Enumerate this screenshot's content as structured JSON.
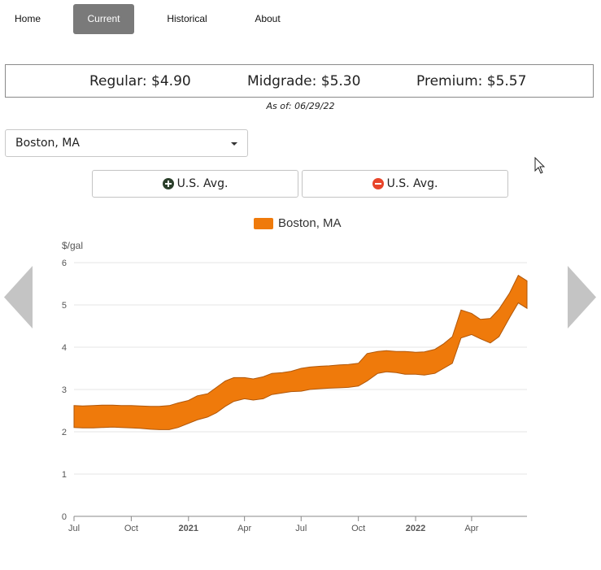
{
  "nav": {
    "items": [
      {
        "label": "Home",
        "active": false
      },
      {
        "label": "Current",
        "active": true
      },
      {
        "label": "Historical",
        "active": false
      },
      {
        "label": "About",
        "active": false
      }
    ]
  },
  "prices": {
    "regular": "Regular: $4.90",
    "midgrade": "Midgrade: $5.30",
    "premium": "Premium: $5.57",
    "as_of": "As of: 06/29/22"
  },
  "location_select": {
    "value": "Boston, MA"
  },
  "buttons": {
    "add_us_avg": "U.S. Avg.",
    "remove_us_avg": "U.S. Avg.",
    "add_icon": "plus-circle-icon",
    "remove_icon": "minus-circle-icon"
  },
  "navigation_arrows": {
    "prev_icon": "chevron-left-icon",
    "next_icon": "chevron-right-icon"
  },
  "colors": {
    "series_fill": "#ef7a0b",
    "series_stroke": "#b0570a",
    "active_tab": "#7a7a7a",
    "arrow": "#c4c4c4",
    "minus_icon": "#e8452a",
    "plus_icon": "#2b3f2b"
  },
  "chart_data": {
    "type": "area",
    "title": "",
    "ylabel": "$/gal",
    "xlabel": "",
    "ylim": [
      0,
      6
    ],
    "yticks": [
      0,
      1,
      2,
      3,
      4,
      5,
      6
    ],
    "grid": true,
    "legend": {
      "position": "top-center"
    },
    "xticks": [
      {
        "label": "Jul",
        "date": "2020-07-01",
        "bold": false
      },
      {
        "label": "Oct",
        "date": "2020-10-01",
        "bold": false
      },
      {
        "label": "2021",
        "date": "2021-01-01",
        "bold": true
      },
      {
        "label": "Apr",
        "date": "2021-04-01",
        "bold": false
      },
      {
        "label": "Jul",
        "date": "2021-07-01",
        "bold": false
      },
      {
        "label": "Oct",
        "date": "2021-10-01",
        "bold": false
      },
      {
        "label": "2022",
        "date": "2022-01-01",
        "bold": true
      },
      {
        "label": "Apr",
        "date": "2022-04-01",
        "bold": false
      }
    ],
    "xrange": [
      "2020-07-01",
      "2022-06-29"
    ],
    "series": [
      {
        "name": "Boston, MA",
        "color": "#ef7a0b",
        "band": true,
        "x": [
          "2020-07-01",
          "2020-07-15",
          "2020-08-01",
          "2020-08-15",
          "2020-09-01",
          "2020-09-15",
          "2020-10-01",
          "2020-10-15",
          "2020-11-01",
          "2020-11-15",
          "2020-12-01",
          "2020-12-15",
          "2021-01-01",
          "2021-01-15",
          "2021-02-01",
          "2021-02-15",
          "2021-03-01",
          "2021-03-15",
          "2021-04-01",
          "2021-04-15",
          "2021-05-01",
          "2021-05-15",
          "2021-06-01",
          "2021-06-15",
          "2021-07-01",
          "2021-07-15",
          "2021-08-01",
          "2021-08-15",
          "2021-09-01",
          "2021-09-15",
          "2021-10-01",
          "2021-10-15",
          "2021-11-01",
          "2021-11-15",
          "2021-12-01",
          "2021-12-15",
          "2022-01-01",
          "2022-01-15",
          "2022-02-01",
          "2022-02-15",
          "2022-03-01",
          "2022-03-15",
          "2022-04-01",
          "2022-04-15",
          "2022-05-01",
          "2022-05-15",
          "2022-06-01",
          "2022-06-15",
          "2022-06-29"
        ],
        "low": [
          2.1,
          2.09,
          2.09,
          2.1,
          2.11,
          2.1,
          2.09,
          2.08,
          2.06,
          2.05,
          2.05,
          2.1,
          2.2,
          2.28,
          2.35,
          2.45,
          2.6,
          2.72,
          2.78,
          2.75,
          2.78,
          2.88,
          2.92,
          2.95,
          2.96,
          3.0,
          3.02,
          3.03,
          3.04,
          3.05,
          3.08,
          3.2,
          3.38,
          3.42,
          3.4,
          3.36,
          3.36,
          3.34,
          3.38,
          3.5,
          3.62,
          4.22,
          4.3,
          4.2,
          4.1,
          4.25,
          4.7,
          5.05,
          4.92
        ],
        "high": [
          2.62,
          2.61,
          2.62,
          2.63,
          2.63,
          2.62,
          2.62,
          2.61,
          2.6,
          2.6,
          2.62,
          2.68,
          2.74,
          2.85,
          2.9,
          3.05,
          3.2,
          3.28,
          3.28,
          3.25,
          3.3,
          3.38,
          3.4,
          3.43,
          3.5,
          3.53,
          3.55,
          3.56,
          3.58,
          3.59,
          3.62,
          3.85,
          3.9,
          3.92,
          3.9,
          3.9,
          3.88,
          3.89,
          3.95,
          4.08,
          4.25,
          4.88,
          4.8,
          4.66,
          4.68,
          4.9,
          5.28,
          5.7,
          5.57
        ]
      }
    ]
  }
}
